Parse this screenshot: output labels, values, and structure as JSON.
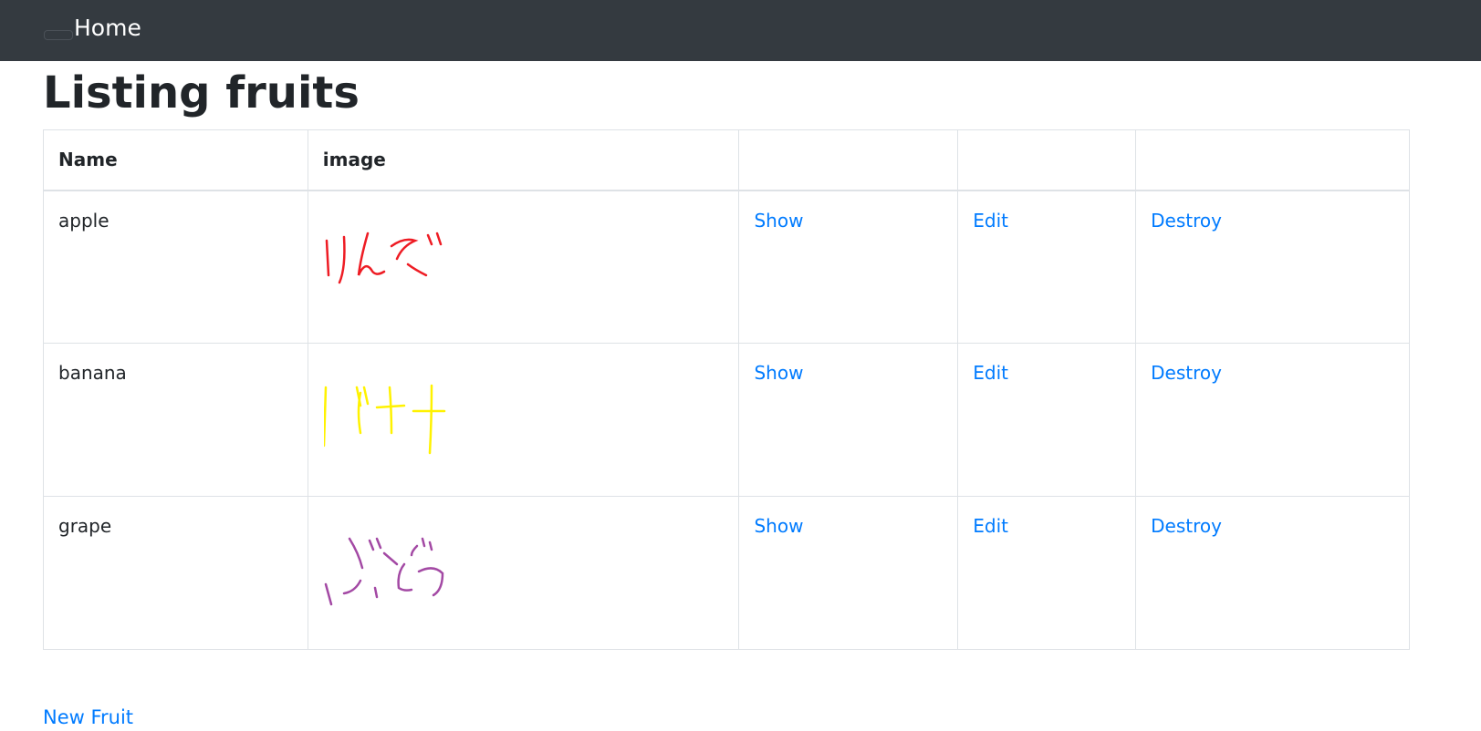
{
  "nav": {
    "home_label": "Home"
  },
  "page": {
    "title": "Listing fruits"
  },
  "table": {
    "headers": [
      "Name",
      "image",
      "",
      "",
      ""
    ],
    "rows": [
      {
        "name": "apple",
        "image_color": "#ee1c24",
        "show": "Show",
        "edit": "Edit",
        "destroy": "Destroy"
      },
      {
        "name": "banana",
        "image_color": "#fff200",
        "show": "Show",
        "edit": "Edit",
        "destroy": "Destroy"
      },
      {
        "name": "grape",
        "image_color": "#a349a4",
        "show": "Show",
        "edit": "Edit",
        "destroy": "Destroy"
      }
    ]
  },
  "actions": {
    "new_fruit_label": "New Fruit"
  },
  "colors": {
    "navbar_bg": "#343a40",
    "link": "#007bff",
    "border": "#dee2e6"
  }
}
